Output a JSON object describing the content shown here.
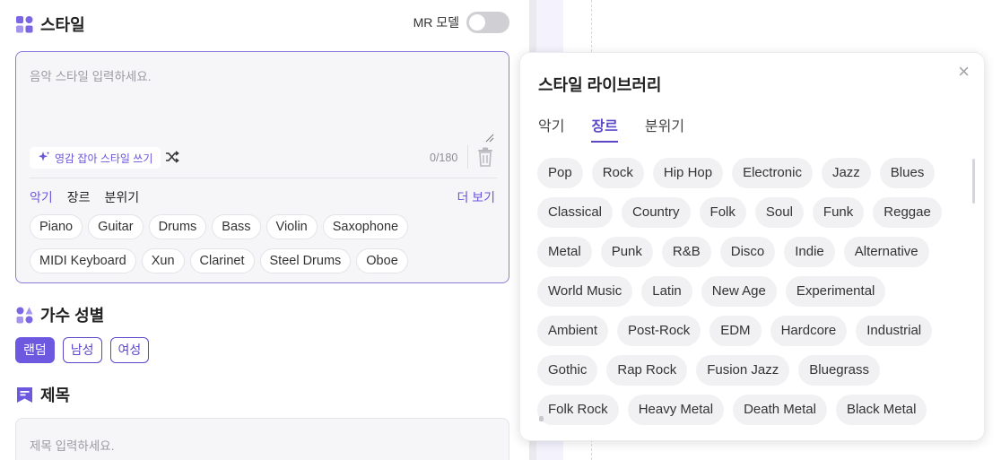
{
  "style_section": {
    "title": "스타일",
    "mr_label": "MR 모델",
    "mr_enabled": false,
    "input_placeholder": "음악 스타일 입력하세요.",
    "inspire_label": "영감 잡아 스타일 쓰기",
    "counter": "0/180",
    "tabs": [
      "악기",
      "장르",
      "분위기"
    ],
    "active_tab": "악기",
    "more_label": "더 보기",
    "chips_row1": [
      "Piano",
      "Guitar",
      "Drums",
      "Bass",
      "Violin",
      "Saxophone"
    ],
    "chips_row2": [
      "MIDI Keyboard",
      "Xun",
      "Clarinet",
      "Steel Drums",
      "Oboe"
    ]
  },
  "singer_section": {
    "title": "가수 성별",
    "options": [
      "랜덤",
      "남성",
      "여성"
    ],
    "selected": "랜덤"
  },
  "title_section": {
    "title": "제목",
    "input_placeholder": "제목 입력하세요."
  },
  "library": {
    "title": "스타일 라이브러리",
    "close_glyph": "×",
    "tabs": [
      "악기",
      "장르",
      "분위기"
    ],
    "active_tab": "장르",
    "genre_rows": [
      [
        "Pop",
        "Rock",
        "Hip Hop",
        "Electronic",
        "Jazz",
        "Blues"
      ],
      [
        "Classical",
        "Country",
        "Folk",
        "Soul",
        "Funk",
        "Reggae"
      ],
      [
        "Metal",
        "Punk",
        "R&B",
        "Disco",
        "Indie",
        "Alternative"
      ],
      [
        "World Music",
        "Latin",
        "New Age",
        "Experimental"
      ],
      [
        "Ambient",
        "Post-Rock",
        "EDM",
        "Hardcore",
        "Industrial"
      ],
      [
        "Gothic",
        "Rap Rock",
        "Fusion Jazz",
        "Bluegrass"
      ],
      [
        "Folk Rock",
        "Heavy Metal",
        "Death Metal",
        "Black Metal"
      ]
    ]
  },
  "icons": {
    "style": "grid-shapes-icon",
    "singer": "singer-shapes-icon",
    "title": "bookmark-title-icon",
    "inspire": "sparkle-icon",
    "shuffle": "shuffle-icon",
    "trash": "trash-icon",
    "close": "close-icon"
  },
  "colors": {
    "accent": "#6d59e0",
    "accent_text": "#5a47c8",
    "chip_bg": "#f1f1f4",
    "border_active": "#8d7bdc"
  }
}
